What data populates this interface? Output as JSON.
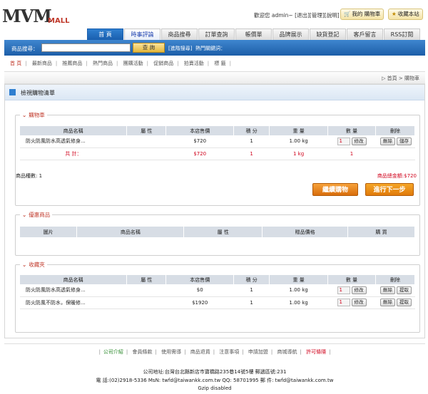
{
  "logo": {
    "main": "MVM",
    "sub": "MALL"
  },
  "top": {
    "welcome": "歡迎您 admin~",
    "links": [
      "[退出]",
      "[管理]",
      "[說明]"
    ],
    "cart_btn": "我的 購物車",
    "fav_btn": "收藏本站"
  },
  "tabs": [
    "首 頁",
    "時事評論",
    "商品搜尋",
    "訂單查詢",
    "帳價單",
    "品牌展示",
    "缺貨登記",
    "客戶留言",
    "RSS訂閱"
  ],
  "search": {
    "label": "商品搜尋：",
    "value": "",
    "button": "查 詢",
    "advanced": "[進階搜尋]",
    "hot_label": "熱門關鍵詞："
  },
  "subnav": [
    "首 頁",
    "最新商品",
    "推薦商品",
    "熱門商品",
    "團購活動",
    "促銷商品",
    "拍賣活動",
    "標 籤"
  ],
  "breadcrumb": "▷ 首頁 > 購物車",
  "panel_title": "檢視購物清單",
  "cart": {
    "title": "購物車",
    "headers": [
      "商品名稱",
      "屬 性",
      "本店售價",
      "積 分",
      "重 量",
      "數 量",
      "刪除"
    ],
    "rows": [
      {
        "name": "防火防風防水高透氣修身...",
        "attr": "",
        "price": "$720",
        "points": "1",
        "weight": "1.00 kg",
        "qty": "1",
        "btn": "修改",
        "del": "刪除",
        "save": "儲存"
      }
    ],
    "total": {
      "label": "共 計：",
      "price": "$720",
      "points": "1",
      "weight": "1 kg",
      "qty": "1"
    },
    "count_label": "商品種數: 1",
    "amount_label": "商品總金額:$720",
    "continue_btn": "繼續購物",
    "next_btn": "進行下一步"
  },
  "offer": {
    "title": "優惠商品",
    "headers": [
      "圖片",
      "商品名稱",
      "屬 性",
      "贈品價格",
      "購 買"
    ]
  },
  "favorites": {
    "title": "收藏夾",
    "headers": [
      "商品名稱",
      "屬 性",
      "本店售價",
      "積 分",
      "重 量",
      "數 量",
      "刪除"
    ],
    "rows": [
      {
        "name": "防火防風防水高透氣修身...",
        "price": "$0",
        "points": "1",
        "weight": "1.00 kg",
        "qty": "1",
        "btn": "修改",
        "del": "刪除",
        "take": "提取"
      },
      {
        "name": "防火防風不防水，保暖修...",
        "price": "$1920",
        "points": "1",
        "weight": "1.00 kg",
        "qty": "1",
        "btn": "修改",
        "del": "刪除",
        "take": "提取"
      }
    ]
  },
  "footer": {
    "links": [
      "公司介紹",
      "會員條款",
      "使用需導",
      "商品退貨",
      "注意事項",
      "申請加盟",
      "商城導航",
      "許可條隱"
    ],
    "address": "公司地址:台灣台北縣新店市寶橋路235巷14號5樓 郵遞區號:231",
    "contact": "電 話:(02)2918-5336  MsN: twfd@taiwankk.com.tw  QQ: 58701995  郵 件: twfd@taiwankk.com.tw",
    "gzip": "Gzip disabled"
  }
}
